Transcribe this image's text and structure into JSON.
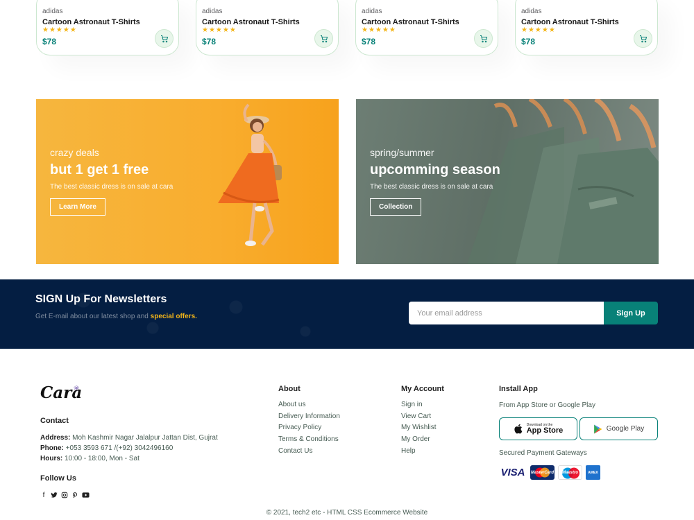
{
  "products": [
    {
      "brand": "adidas",
      "name": "Cartoon Astronaut T-Shirts",
      "stars": "★★★★★",
      "rating": 5,
      "price": "$78"
    },
    {
      "brand": "adidas",
      "name": "Cartoon Astronaut T-Shirts",
      "stars": "★★★★★",
      "rating": 5,
      "price": "$78"
    },
    {
      "brand": "adidas",
      "name": "Cartoon Astronaut T-Shirts",
      "stars": "★★★★★",
      "rating": 5,
      "price": "$78"
    },
    {
      "brand": "adidas",
      "name": "Cartoon Astronaut T-Shirts",
      "stars": "★★★★★",
      "rating": 5,
      "price": "$78"
    }
  ],
  "banners": {
    "left": {
      "small": "crazy deals",
      "big": "but 1 get 1 free",
      "desc": "The best classic dress is on sale at cara",
      "button": "Learn More"
    },
    "right": {
      "small": "spring/summer",
      "big": "upcomming season",
      "desc": "The best classic dress is on sale at cara",
      "button": "Collection"
    }
  },
  "newsletter": {
    "title": "SIGN Up For Newsletters",
    "sub_prefix": "Get E-mail about our latest shop and ",
    "sub_highlight": "special offers.",
    "placeholder": "Your email address",
    "button": "Sign Up"
  },
  "footer": {
    "logo": "Cara",
    "contact": {
      "heading": "Contact",
      "address_label": "Address:",
      "address": " Moh Kashmir Nagar Jalalpur Jattan Dist, Gujrat",
      "phone_label": "Phone:",
      "phone": " +053 3593 671 /(+92) 3042496160",
      "hours_label": "Hours:",
      "hours": " 10:00 - 18:00, Mon - Sat"
    },
    "follow_heading": "Follow Us",
    "social_icons": [
      "facebook-icon",
      "twitter-icon",
      "instagram-icon",
      "pinterest-icon",
      "youtube-icon"
    ],
    "about": {
      "heading": "About",
      "links": [
        "About us",
        "Delivery Information",
        "Privacy Policy",
        "Terms & Conditions",
        "Contact Us"
      ]
    },
    "account": {
      "heading": "My Account",
      "links": [
        "Sign in",
        "View Cart",
        "My Wishlist",
        "My Order",
        "Help"
      ]
    },
    "install": {
      "heading": "Install App",
      "sub": "From App Store or Google Play",
      "appstore_small": "Download on the",
      "appstore": "App Store",
      "googleplay": "Google Play",
      "payments_heading": "Secured Payment Gateways",
      "payments": {
        "visa": "VISA",
        "mastercard": "MasterCard",
        "maestro": "Maestro",
        "amex": "AMEX"
      }
    },
    "copyright": "© 2021, tech2 etc - HTML CSS Ecommerce Website"
  },
  "colors": {
    "accent": "#088178",
    "star": "#f3b519",
    "newsletter_bg": "#041e42",
    "deal_banner": "#f9ad2e"
  }
}
